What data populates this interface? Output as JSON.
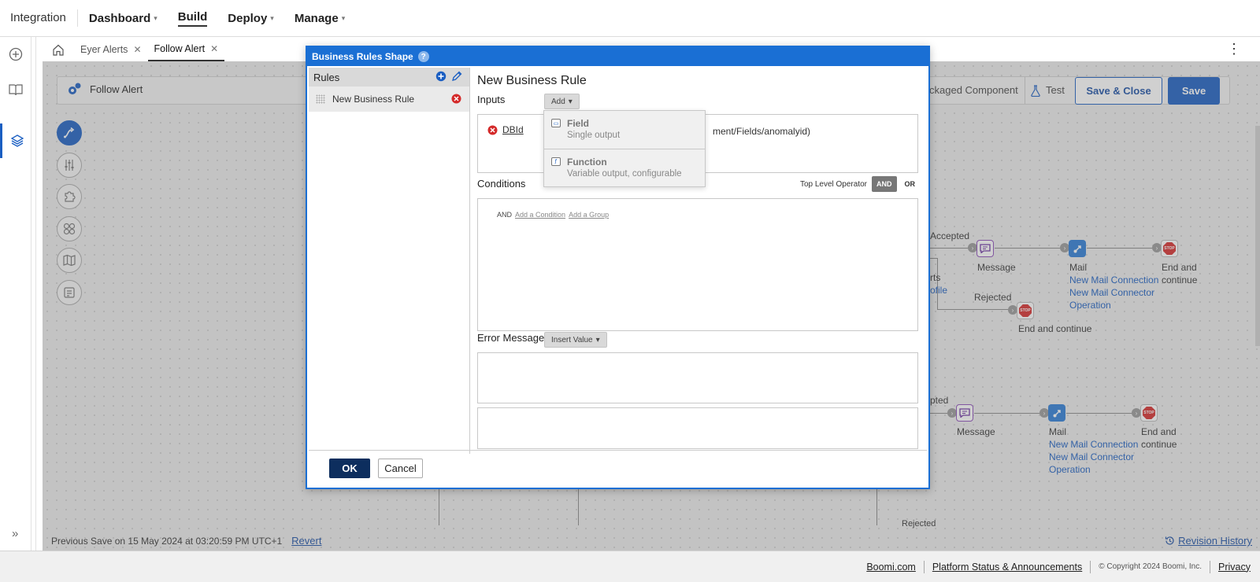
{
  "topnav": {
    "brand": "Integration",
    "items": [
      {
        "label": "Dashboard",
        "has_caret": true
      },
      {
        "label": "Build",
        "has_caret": false
      },
      {
        "label": "Deploy",
        "has_caret": true
      },
      {
        "label": "Manage",
        "has_caret": true
      }
    ]
  },
  "tabs": [
    {
      "label": "Eyer Alerts"
    },
    {
      "label": "Follow Alert"
    }
  ],
  "process": {
    "title": "Follow Alert",
    "packaged_label": "ckaged Component",
    "test_label": "Test",
    "save_close_label": "Save & Close",
    "save_label": "Save"
  },
  "canvas": {
    "accepted_1": "Accepted",
    "rejected_1": "Rejected",
    "partial_1": "rts",
    "partial_link_1": "ofile",
    "accepted_2": "pted",
    "rejected_2": "Rejected",
    "message_label": "Message",
    "mail_label": "Mail",
    "mail_conn": "New Mail Connection",
    "mail_op_1": "New Mail Connector",
    "mail_op_2": "Operation",
    "end_line1": "End and",
    "end_line2": "continue",
    "end_full": "End and continue",
    "stop_text": "STOP"
  },
  "status": {
    "previous_save": "Previous Save on 15 May 2024 at 03:20:59 PM UTC+1",
    "revert": "Revert",
    "revision_history": "Revision History"
  },
  "footer": {
    "boomi": "Boomi.com",
    "platform": "Platform Status & Announcements",
    "copyright": "© Copyright 2024 Boomi, Inc.",
    "privacy": "Privacy"
  },
  "modal": {
    "title": "Business Rules Shape",
    "help": "?",
    "rules_header": "Rules",
    "rule_item": "New Business Rule",
    "rule_title": "New Business Rule",
    "inputs_label": "Inputs",
    "add_label": "Add",
    "input_name": "DBId",
    "input_path_tail": "ment/Fields/anomalyid)",
    "conditions_label": "Conditions",
    "top_level_operator": "Top Level Operator",
    "and_label": "AND",
    "or_label": "OR",
    "cond_and": "AND",
    "add_condition": "Add a Condition",
    "add_group": "Add a Group",
    "error_message_label": "Error Message",
    "insert_value_label": "Insert Value",
    "ok_label": "OK",
    "cancel_label": "Cancel"
  },
  "add_menu": [
    {
      "title": "Field",
      "subtitle": "Single output"
    },
    {
      "title": "Function",
      "subtitle": "Variable output, configurable"
    }
  ]
}
